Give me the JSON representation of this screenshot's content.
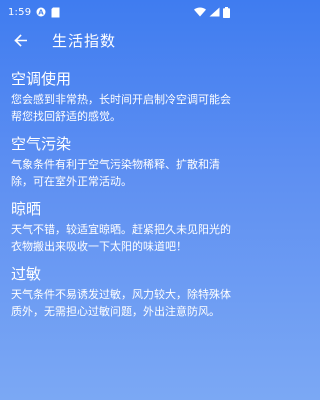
{
  "status_bar": {
    "time": "1:59"
  },
  "app_bar": {
    "title": "生活指数"
  },
  "sections": [
    {
      "title": "空调使用",
      "body": "您会感到非常热，长时间开启制冷空调可能会帮您找回舒适的感觉。"
    },
    {
      "title": "空气污染",
      "body": "气象条件有利于空气污染物稀释、扩散和清除，可在室外正常活动。"
    },
    {
      "title": "晾晒",
      "body": "天气不错，较适宜晾晒。赶紧把久未见阳光的衣物搬出来吸收一下太阳的味道吧！"
    },
    {
      "title": "过敏",
      "body": "天气条件不易诱发过敏，风力较大，除特殊体质外，无需担心过敏问题，外出注意防风。"
    }
  ]
}
